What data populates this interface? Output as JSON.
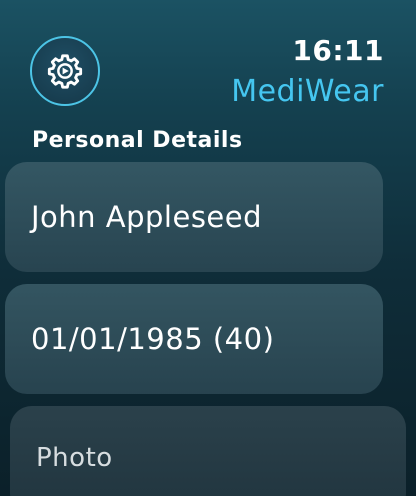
{
  "header": {
    "time": "16:11",
    "app_name": "MediWear",
    "settings_icon": "gear-icon",
    "accent_color": "#45c6f0"
  },
  "section": {
    "title": "Personal Details"
  },
  "fields": {
    "name": "John Appleseed",
    "dob": "01/01/1985 (40)",
    "photo_placeholder": "Photo"
  }
}
